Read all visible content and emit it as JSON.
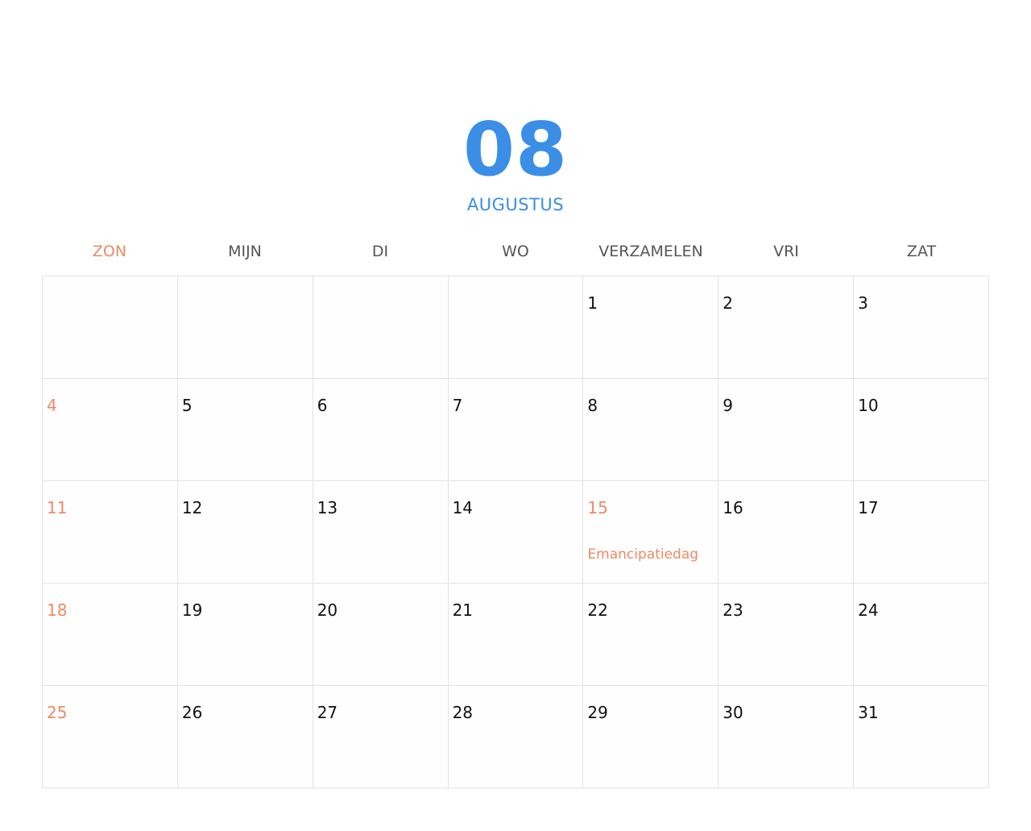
{
  "calendar": {
    "month_number": "08",
    "month_name": "AUGUSTUS",
    "weekdays": [
      "ZON",
      "MIJN",
      "DI",
      "WO",
      "VERZAMELEN",
      "VRI",
      "ZAT"
    ],
    "first_weekday_index": 4,
    "days_in_month": 31,
    "holidays": [
      {
        "day": 15,
        "name": "Emancipatiedag"
      }
    ]
  },
  "colors": {
    "accent": "#3a8ee6",
    "sunday": "#ee8a64",
    "holiday": "#ee8a64",
    "weekday_text": "#555555",
    "day_text": "#111111",
    "grid_line": "#e3e3e3"
  }
}
